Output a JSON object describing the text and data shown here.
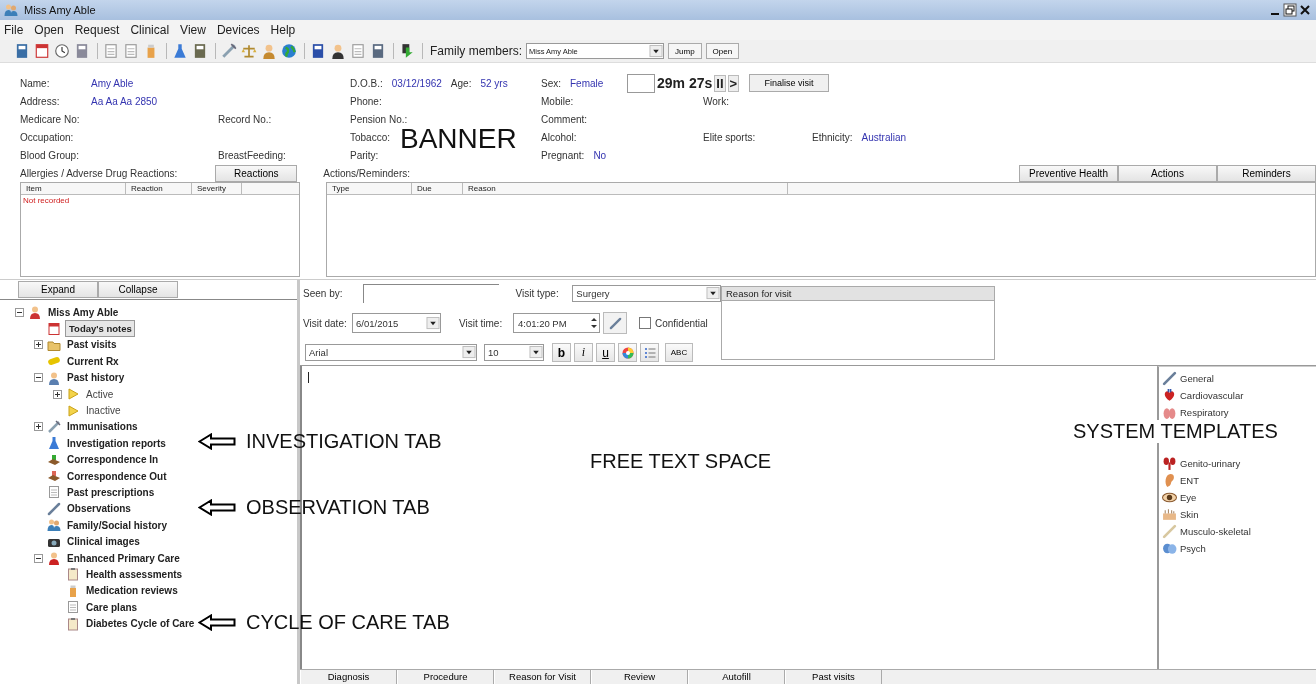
{
  "window": {
    "title": "Miss Amy Able"
  },
  "menu": [
    "File",
    "Open",
    "Request",
    "Clinical",
    "View",
    "Devices",
    "Help"
  ],
  "toolbar": {
    "family_label": "Family members:",
    "family_value": "Miss Amy Able",
    "buttons": [
      "Jump",
      "Open"
    ]
  },
  "banner": {
    "annotation": "BANNER",
    "timer": {
      "elapsed": "29m 27s",
      "pause": "II",
      "play": ">"
    },
    "finalise_button": "Finalise visit",
    "rows": [
      [
        [
          {
            "label": "Name:",
            "value": "Amy Able"
          }
        ],
        null,
        [
          {
            "label": "D.O.B.:",
            "value": "03/12/1962"
          },
          {
            "label": "Age:",
            "value": "52 yrs"
          }
        ],
        [
          {
            "label": "Sex:",
            "value": "Female"
          }
        ],
        null,
        null
      ],
      [
        [
          {
            "label": "Address:",
            "value": "Aa Aa Aa 2850"
          }
        ],
        null,
        [
          {
            "label": "Phone:"
          }
        ],
        [
          {
            "label": "Mobile:"
          }
        ],
        [
          {
            "label": "Work:"
          }
        ],
        null
      ],
      [
        [
          {
            "label": "Medicare No:"
          }
        ],
        [
          {
            "label": "Record No.:"
          }
        ],
        [
          {
            "label": "Pension No.:"
          }
        ],
        [
          {
            "label": "Comment:"
          }
        ],
        null,
        null
      ],
      [
        [
          {
            "label": "Occupation:"
          }
        ],
        null,
        [
          {
            "label": "Tobacco:"
          }
        ],
        [
          {
            "label": "Alcohol:"
          }
        ],
        [
          {
            "label": "Elite sports:"
          }
        ],
        [
          {
            "label": "Ethnicity:",
            "value": "Australian"
          }
        ]
      ],
      [
        [
          {
            "label": "Blood Group:"
          }
        ],
        [
          {
            "label": "BreastFeeding:"
          }
        ],
        [
          {
            "label": "Parity:"
          }
        ],
        [
          {
            "label": "Pregnant:",
            "value": "No"
          }
        ],
        null,
        null
      ]
    ]
  },
  "allergies": {
    "label": "Allergies / Adverse Drug Reactions:",
    "button": "Reactions",
    "columns": [
      "Item",
      "Reaction",
      "Severity"
    ],
    "rows": [
      "Not recorded"
    ]
  },
  "actions": {
    "label": "Actions/Reminders:",
    "buttons": [
      "Preventive Health",
      "Actions",
      "Reminders"
    ],
    "columns": [
      "Type",
      "Due",
      "Reason"
    ]
  },
  "tree": {
    "buttons": [
      "Expand",
      "Collapse"
    ],
    "items": [
      {
        "label": "Miss Amy Able",
        "expanded": true,
        "selected": false,
        "children": [
          {
            "label": "Today's notes",
            "selected": true
          },
          {
            "label": "Past visits",
            "expanded": false,
            "selected": false
          },
          {
            "label": "Current Rx",
            "selected": false
          },
          {
            "label": "Past history",
            "expanded": true,
            "selected": false,
            "children": [
              {
                "label": "Active",
                "expanded": false,
                "selected": false,
                "dimmed": true
              },
              {
                "label": "Inactive",
                "selected": false,
                "dimmed": true
              }
            ]
          },
          {
            "label": "Immunisations",
            "expanded": false,
            "selected": false
          },
          {
            "label": "Investigation reports",
            "selected": false,
            "annotation": "INVESTIGATION TAB"
          },
          {
            "label": "Correspondence In",
            "selected": false
          },
          {
            "label": "Correspondence Out",
            "selected": false
          },
          {
            "label": "Past prescriptions",
            "selected": false
          },
          {
            "label": "Observations",
            "selected": false,
            "annotation": "OBSERVATION TAB"
          },
          {
            "label": "Family/Social history",
            "selected": false
          },
          {
            "label": "Clinical images",
            "selected": false
          },
          {
            "label": "Enhanced Primary Care",
            "expanded": true,
            "selected": false,
            "children": [
              {
                "label": "Health assessments",
                "selected": false
              },
              {
                "label": "Medication reviews",
                "selected": false
              },
              {
                "label": "Care plans",
                "selected": false
              },
              {
                "label": "Diabetes Cycle of Care",
                "selected": false,
                "annotation": "CYCLE OF CARE TAB"
              }
            ]
          }
        ]
      }
    ]
  },
  "visit": {
    "seen_by_label": "Seen by:",
    "visit_type_label": "Visit type:",
    "visit_type": "Surgery",
    "visit_date_label": "Visit date:",
    "visit_date": "6/01/2015",
    "visit_time_label": "Visit time:",
    "visit_time": "4:01:20 PM",
    "confidential": {
      "label": "Confidential",
      "checked": false
    },
    "font": "Arial",
    "size": "10",
    "format_buttons": [
      {
        "kind": "bold",
        "label": "b"
      },
      {
        "kind": "italic",
        "label": "i"
      },
      {
        "kind": "underline",
        "label": "u"
      },
      {
        "kind": "color"
      },
      {
        "kind": "list"
      },
      {
        "kind": "spell",
        "label": "ABC"
      }
    ],
    "reason_title": "Reason for visit"
  },
  "editor": {
    "annotation": "FREE TEXT SPACE"
  },
  "templates": {
    "annotation": "SYSTEM TEMPLATES",
    "items": [
      "General",
      "Cardiovascular",
      "Respiratory",
      "Genito-urinary",
      "ENT",
      "Eye",
      "Skin",
      "Musculo-skeletal",
      "Psych"
    ]
  },
  "bottom_tabs": [
    "Diagnosis",
    "Procedure",
    "Reason for Visit",
    "Review",
    "Autofill",
    "Past visits"
  ]
}
